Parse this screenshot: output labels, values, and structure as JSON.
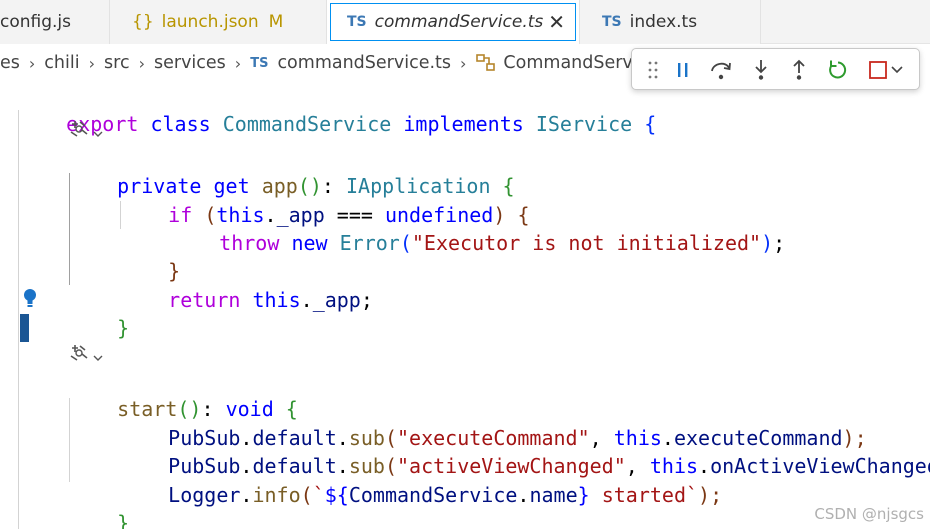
{
  "tabs": [
    {
      "label": "config.js",
      "lang_icon": "",
      "modified": ""
    },
    {
      "label": "launch.json",
      "lang_icon": "{}",
      "modified": "M"
    },
    {
      "label": "commandService.ts",
      "lang_icon": "TS",
      "modified": "",
      "active": true
    },
    {
      "label": "index.ts",
      "lang_icon": "TS",
      "modified": ""
    }
  ],
  "breadcrumb": {
    "items": [
      "es",
      "chili",
      "src",
      "services",
      "commandService.ts",
      "CommandServi"
    ],
    "file_icon": "TS"
  },
  "debug_toolbar": {
    "buttons": [
      "pause",
      "step-over",
      "step-into",
      "step-out",
      "restart",
      "stop"
    ]
  },
  "code": {
    "line1": {
      "export": "export",
      "class": "class",
      "name": "CommandService",
      "implements": "implements",
      "iface": "IService",
      "brace": "{"
    },
    "get_block": {
      "private": "private",
      "get": "get",
      "fn": "app",
      "parens": "()",
      "colon": ":",
      "type": "IApplication",
      "brace": "{",
      "if": "if",
      "open": "(",
      "this": "this",
      "dot": ".",
      "prop": "_app",
      "op": "===",
      "undef": "undefined",
      "close": ")",
      "ifbrace": "{",
      "throw": "throw",
      "new": "new",
      "err": "Error",
      "msg": "\"Executor is not initialized\"",
      "end": ");",
      "endif": "}",
      "return": "return",
      "ret_this": "this",
      "ret_dot": ".",
      "ret_prop": "_app",
      "semi": ";",
      "endfn": "}"
    },
    "start_block": {
      "fn": "start",
      "parens": "()",
      "colon": ":",
      "type": "void",
      "brace": "{",
      "l1": {
        "obj": "PubSub",
        "d1": ".",
        "p1": "default",
        "d2": ".",
        "m": "sub",
        "open": "(",
        "s": "\"executeCommand\"",
        "comma": ",",
        "this": "this",
        "d3": ".",
        "p2": "executeCommand",
        "close": ");"
      },
      "l2": {
        "obj": "PubSub",
        "d1": ".",
        "p1": "default",
        "d2": ".",
        "m": "sub",
        "open": "(",
        "s": "\"activeViewChanged\"",
        "comma": ",",
        "this": "this",
        "d3": ".",
        "p2": "onActiveViewChanged"
      },
      "l3": {
        "obj": "Logger",
        "d1": ".",
        "m": "info",
        "open": "(",
        "t1": "`",
        "t2": "${",
        "cls": "CommandService",
        "d2": ".",
        "p": "name",
        "t3": "}",
        "t4": " started`",
        "close": ");"
      },
      "endfn": "}"
    }
  },
  "watermark": "CSDN @njsgcs"
}
